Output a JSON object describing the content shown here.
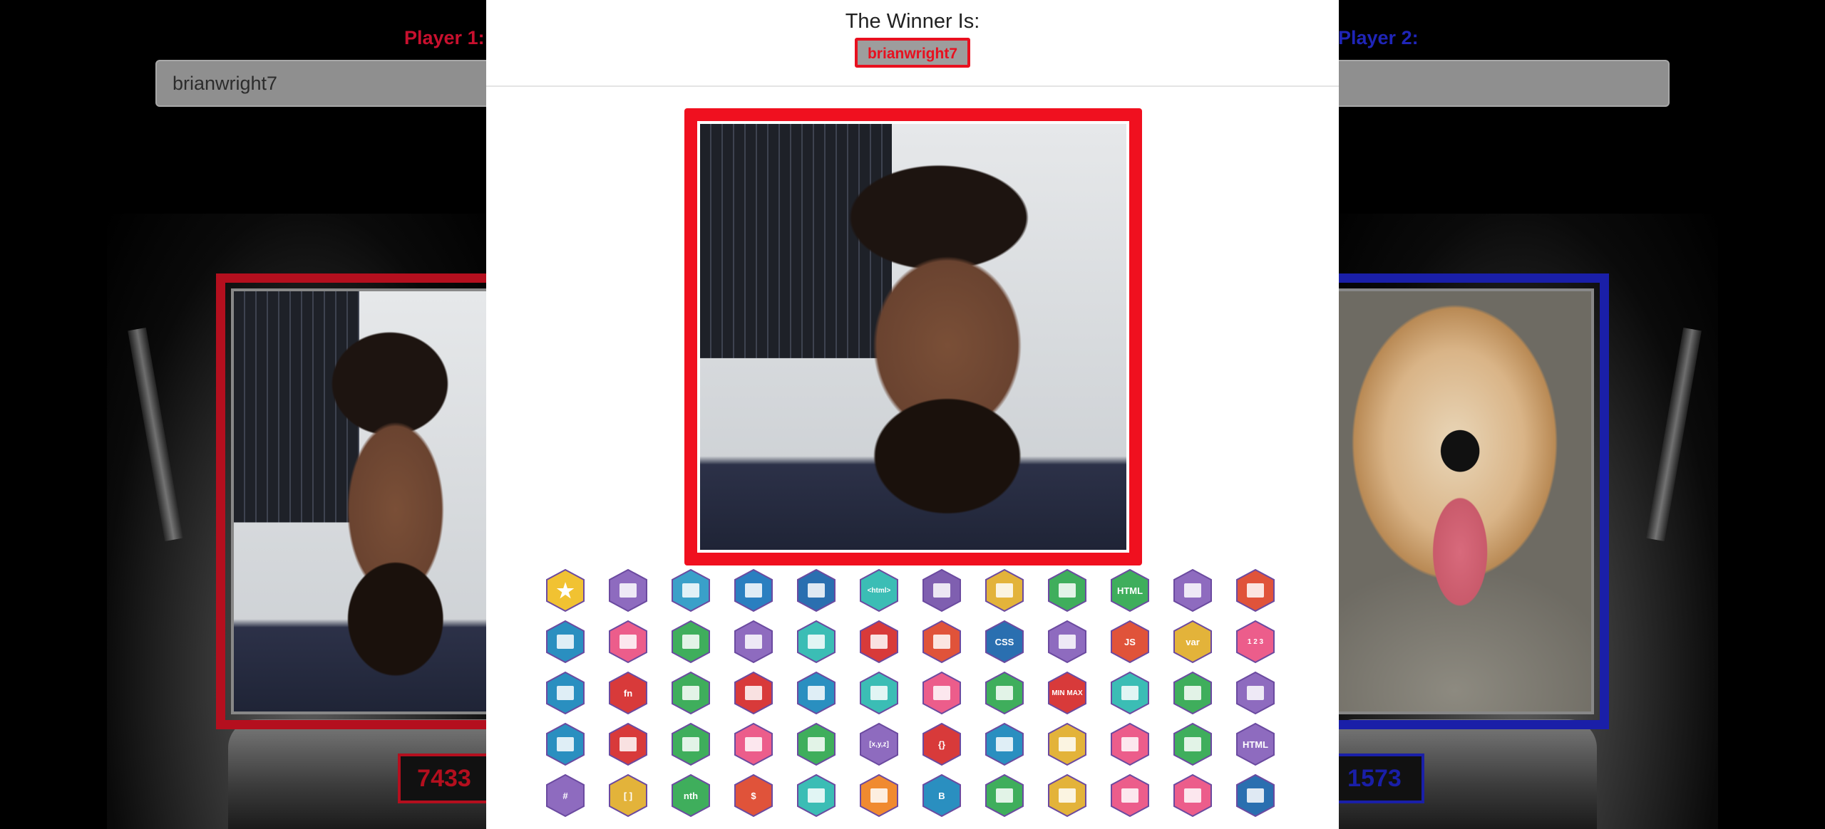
{
  "players": {
    "p1": {
      "label": "Player 1:",
      "username": "brianwright7",
      "score": "7433"
    },
    "p2": {
      "label": "Player 2:",
      "username": "",
      "score": "1573"
    }
  },
  "modal": {
    "title": "The Winner Is:",
    "winner": "brianwright7"
  },
  "colors": {
    "player1": "#b40f1e",
    "player2": "#1a1fa8",
    "winner_border": "#f0101f"
  },
  "badges": [
    {
      "icon": "star-icon",
      "color": "#f1c232",
      "text": "★"
    },
    {
      "icon": "image-icon",
      "color": "#8e6bbf",
      "text": ""
    },
    {
      "icon": "laptop-icon",
      "color": "#3aa0c9",
      "text": ""
    },
    {
      "icon": "wifi-icon",
      "color": "#2a7fc0",
      "text": ""
    },
    {
      "icon": "globe-icon",
      "color": "#2a6fb0",
      "text": ""
    },
    {
      "icon": "html-css-icon",
      "color": "#3bbdb5",
      "text": "<html>"
    },
    {
      "icon": "browser-icon",
      "color": "#7f5fb0",
      "text": ""
    },
    {
      "icon": "window-icon",
      "color": "#e3b33a",
      "text": ""
    },
    {
      "icon": "page-add-icon",
      "color": "#3fae5c",
      "text": ""
    },
    {
      "icon": "html-doc-icon",
      "color": "#3fae5c",
      "text": "HTML"
    },
    {
      "icon": "layout-icon",
      "color": "#8e6bbf",
      "text": ""
    },
    {
      "icon": "webpage-icon",
      "color": "#e0533a",
      "text": ""
    },
    {
      "icon": "rocket-icon",
      "color": "#2a8fc0",
      "text": ""
    },
    {
      "icon": "book-icon",
      "color": "#ec5d8b",
      "text": ""
    },
    {
      "icon": "form-icon",
      "color": "#3fae5c",
      "text": ""
    },
    {
      "icon": "camera-icon",
      "color": "#8e6bbf",
      "text": ""
    },
    {
      "icon": "screen-icon",
      "color": "#3bbdb5",
      "text": ""
    },
    {
      "icon": "select-icon",
      "color": "#d83a3a",
      "text": ""
    },
    {
      "icon": "article-icon",
      "color": "#e0533a",
      "text": ""
    },
    {
      "icon": "css-icon",
      "color": "#2a6fb0",
      "text": "CSS"
    },
    {
      "icon": "css-doc-icon",
      "color": "#8e6bbf",
      "text": ""
    },
    {
      "icon": "js-icon",
      "color": "#e0533a",
      "text": "JS"
    },
    {
      "icon": "var-icon",
      "color": "#e3b33a",
      "text": "var"
    },
    {
      "icon": "numbers-icon",
      "color": "#ec5d8b",
      "text": "1 2 3"
    },
    {
      "icon": "graph-icon",
      "color": "#2a8fc0",
      "text": ""
    },
    {
      "icon": "function-icon",
      "color": "#d83a3a",
      "text": "fn"
    },
    {
      "icon": "image-text-icon",
      "color": "#3fae5c",
      "text": ""
    },
    {
      "icon": "headline-icon",
      "color": "#d83a3a",
      "text": ""
    },
    {
      "icon": "email-icon",
      "color": "#2a8fc0",
      "text": ""
    },
    {
      "icon": "gallery-icon",
      "color": "#3bbdb5",
      "text": ""
    },
    {
      "icon": "media-icon",
      "color": "#ec5d8b",
      "text": ""
    },
    {
      "icon": "monitor-icon",
      "color": "#3fae5c",
      "text": ""
    },
    {
      "icon": "minmax-icon",
      "color": "#d83a3a",
      "text": "MIN MAX"
    },
    {
      "icon": "columns-icon",
      "color": "#3bbdb5",
      "text": ""
    },
    {
      "icon": "cards-icon",
      "color": "#3fae5c",
      "text": ""
    },
    {
      "icon": "grid-icon",
      "color": "#8e6bbf",
      "text": ""
    },
    {
      "icon": "table-icon",
      "color": "#2a8fc0",
      "text": ""
    },
    {
      "icon": "dark-book-icon",
      "color": "#d83a3a",
      "text": ""
    },
    {
      "icon": "list-icon",
      "color": "#3fae5c",
      "text": ""
    },
    {
      "icon": "progress-icon",
      "color": "#ec5d8b",
      "text": ""
    },
    {
      "icon": "refresh-icon",
      "color": "#3fae5c",
      "text": ""
    },
    {
      "icon": "xyz-icon",
      "color": "#8e6bbf",
      "text": "[x,y,z]"
    },
    {
      "icon": "braces-icon",
      "color": "#d83a3a",
      "text": "{}"
    },
    {
      "icon": "cloud-icon",
      "color": "#2a8fc0",
      "text": ""
    },
    {
      "icon": "chat-icon",
      "color": "#e3b33a",
      "text": ""
    },
    {
      "icon": "stack-icon",
      "color": "#ec5d8b",
      "text": ""
    },
    {
      "icon": "note-icon",
      "color": "#3fae5c",
      "text": ""
    },
    {
      "icon": "html-window-icon",
      "color": "#8e6bbf",
      "text": "HTML"
    },
    {
      "icon": "hashtag-icon",
      "color": "#8e6bbf",
      "text": "#"
    },
    {
      "icon": "brackets-icon",
      "color": "#e3b33a",
      "text": "[ ]"
    },
    {
      "icon": "nth-icon",
      "color": "#3fae5c",
      "text": "nth"
    },
    {
      "icon": "dollar-icon",
      "color": "#e0533a",
      "text": "$"
    },
    {
      "icon": "tasks-icon",
      "color": "#3bbdb5",
      "text": ""
    },
    {
      "icon": "badge-icon",
      "color": "#f08a30",
      "text": ""
    },
    {
      "icon": "bootstrap-icon",
      "color": "#2a8fc0",
      "text": "B"
    },
    {
      "icon": "spreadsheet-icon",
      "color": "#3fae5c",
      "text": ""
    },
    {
      "icon": "toggle-icon",
      "color": "#e3b33a",
      "text": ""
    },
    {
      "icon": "server-icon",
      "color": "#ec5d8b",
      "text": ""
    },
    {
      "icon": "document-icon",
      "color": "#ec5d8b",
      "text": ""
    },
    {
      "icon": "chart-icon",
      "color": "#2a6fb0",
      "text": ""
    }
  ]
}
